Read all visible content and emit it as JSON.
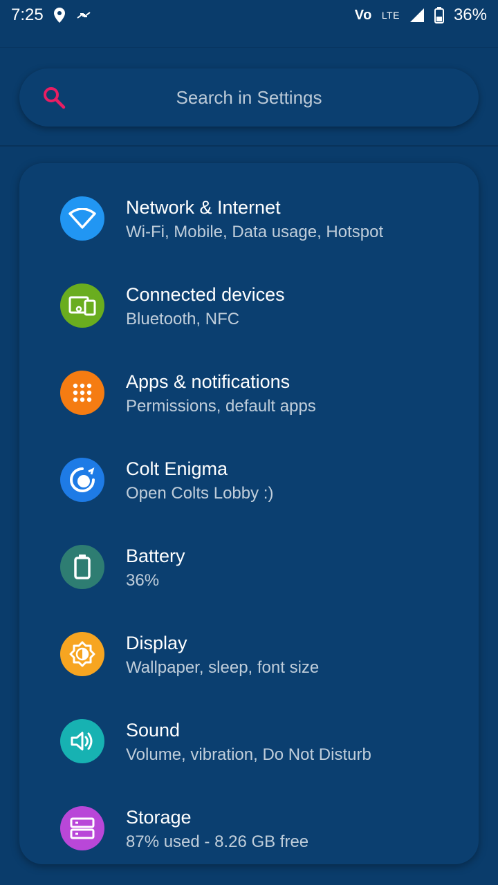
{
  "status_bar": {
    "time": "7:25",
    "volte": "Vo",
    "network": "LTE",
    "battery_pct": "36%"
  },
  "search": {
    "placeholder": "Search in Settings",
    "accent": "#e91e63"
  },
  "items": [
    {
      "title": "Network & Internet",
      "subtitle": "Wi-Fi, Mobile, Data usage, Hotspot",
      "icon": "wifi-icon",
      "color": "#2196f3"
    },
    {
      "title": "Connected devices",
      "subtitle": "Bluetooth, NFC",
      "icon": "devices-icon",
      "color": "#6aad1f"
    },
    {
      "title": "Apps & notifications",
      "subtitle": "Permissions, default apps",
      "icon": "apps-grid-icon",
      "color": "#f57c12"
    },
    {
      "title": "Colt Enigma",
      "subtitle": "Open Colts Lobby :)",
      "icon": "colt-icon",
      "color": "#1e7be6"
    },
    {
      "title": "Battery",
      "subtitle": "36%",
      "icon": "battery-icon",
      "color": "#2e7d72"
    },
    {
      "title": "Display",
      "subtitle": "Wallpaper, sleep, font size",
      "icon": "brightness-icon",
      "color": "#f7a521"
    },
    {
      "title": "Sound",
      "subtitle": "Volume, vibration, Do Not Disturb",
      "icon": "volume-icon",
      "color": "#17b2b2"
    },
    {
      "title": "Storage",
      "subtitle": "87% used - 8.26 GB free",
      "icon": "storage-icon",
      "color": "#b947d8"
    }
  ],
  "colors": {
    "background": "#0a3c6b",
    "card": "#0b3f70"
  }
}
